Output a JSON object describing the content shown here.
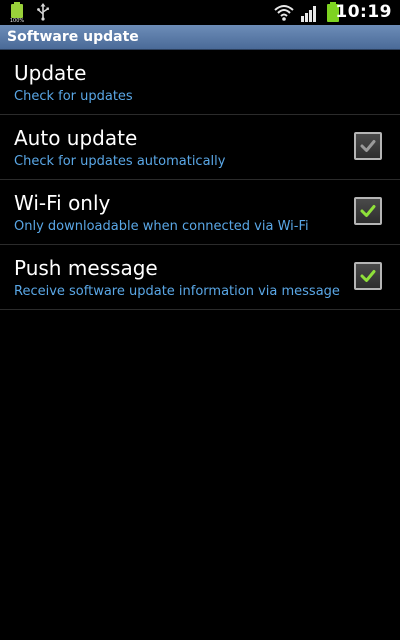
{
  "status_bar": {
    "time": "10:19",
    "left_icons": [
      "battery-full-notification-icon",
      "usb-icon"
    ],
    "right_icons": [
      "wifi-icon",
      "signal-icon",
      "battery-icon"
    ]
  },
  "title_bar": {
    "title": "Software update"
  },
  "settings": {
    "items": [
      {
        "title": "Update",
        "subtitle": "Check for updates",
        "has_checkbox": false
      },
      {
        "title": "Auto update",
        "subtitle": "Check for updates automatically",
        "has_checkbox": true,
        "checked": true,
        "enabled": false
      },
      {
        "title": "Wi-Fi only",
        "subtitle": "Only downloadable when connected via Wi-Fi",
        "has_checkbox": true,
        "checked": true,
        "enabled": true
      },
      {
        "title": "Push message",
        "subtitle": "Receive software update information via message",
        "has_checkbox": true,
        "checked": true,
        "enabled": true
      }
    ]
  },
  "colors": {
    "background": "#000000",
    "title_bar": "#5a7aa8",
    "subtitle_text": "#5aa7e6",
    "check_enabled": "#8fe03a",
    "check_disabled": "#9a9a9a",
    "battery": "#7ed321"
  }
}
